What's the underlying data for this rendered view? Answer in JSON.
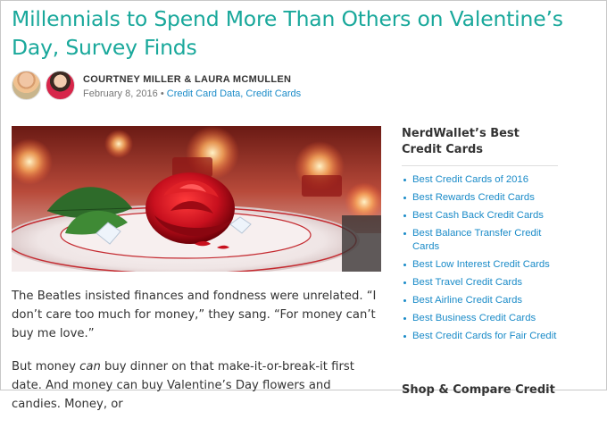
{
  "article": {
    "title": "Millennials to Spend More Than Others on Valentine’s Day, Survey Finds",
    "authors": "COURTNEY MILLER & LAURA MCMULLEN",
    "date": "February 8, 2016",
    "separator": "•",
    "categories": "Credit Card Data, Credit Cards",
    "paragraphs": [
      {
        "before": "The Beatles insisted finances and fondness were unrelated. “I don’t care too much for money,” they sang. “For money can’t buy me love.”",
        "em": "",
        "after": ""
      },
      {
        "before": "But money ",
        "em": "can",
        "after": " buy dinner on that make-it-or-break-it first date. And money can buy Valentine’s Day flowers and candies. Money, or"
      }
    ]
  },
  "sidebar": {
    "heading": "NerdWallet’s Best Credit Cards",
    "links": [
      "Best Credit Cards of 2016",
      "Best Rewards Credit Cards",
      "Best Cash Back Credit Cards",
      "Best Balance Transfer Credit Cards",
      "Best Low Interest Credit Cards",
      "Best Travel Credit Cards",
      "Best Airline Credit Cards",
      "Best Business Credit Cards",
      "Best Credit Cards for Fair Credit"
    ],
    "next_heading": "Shop & Compare Credit"
  },
  "colors": {
    "title": "#19a89b",
    "link": "#1a8bc8",
    "text": "#333333",
    "rose": "#c8101e"
  }
}
